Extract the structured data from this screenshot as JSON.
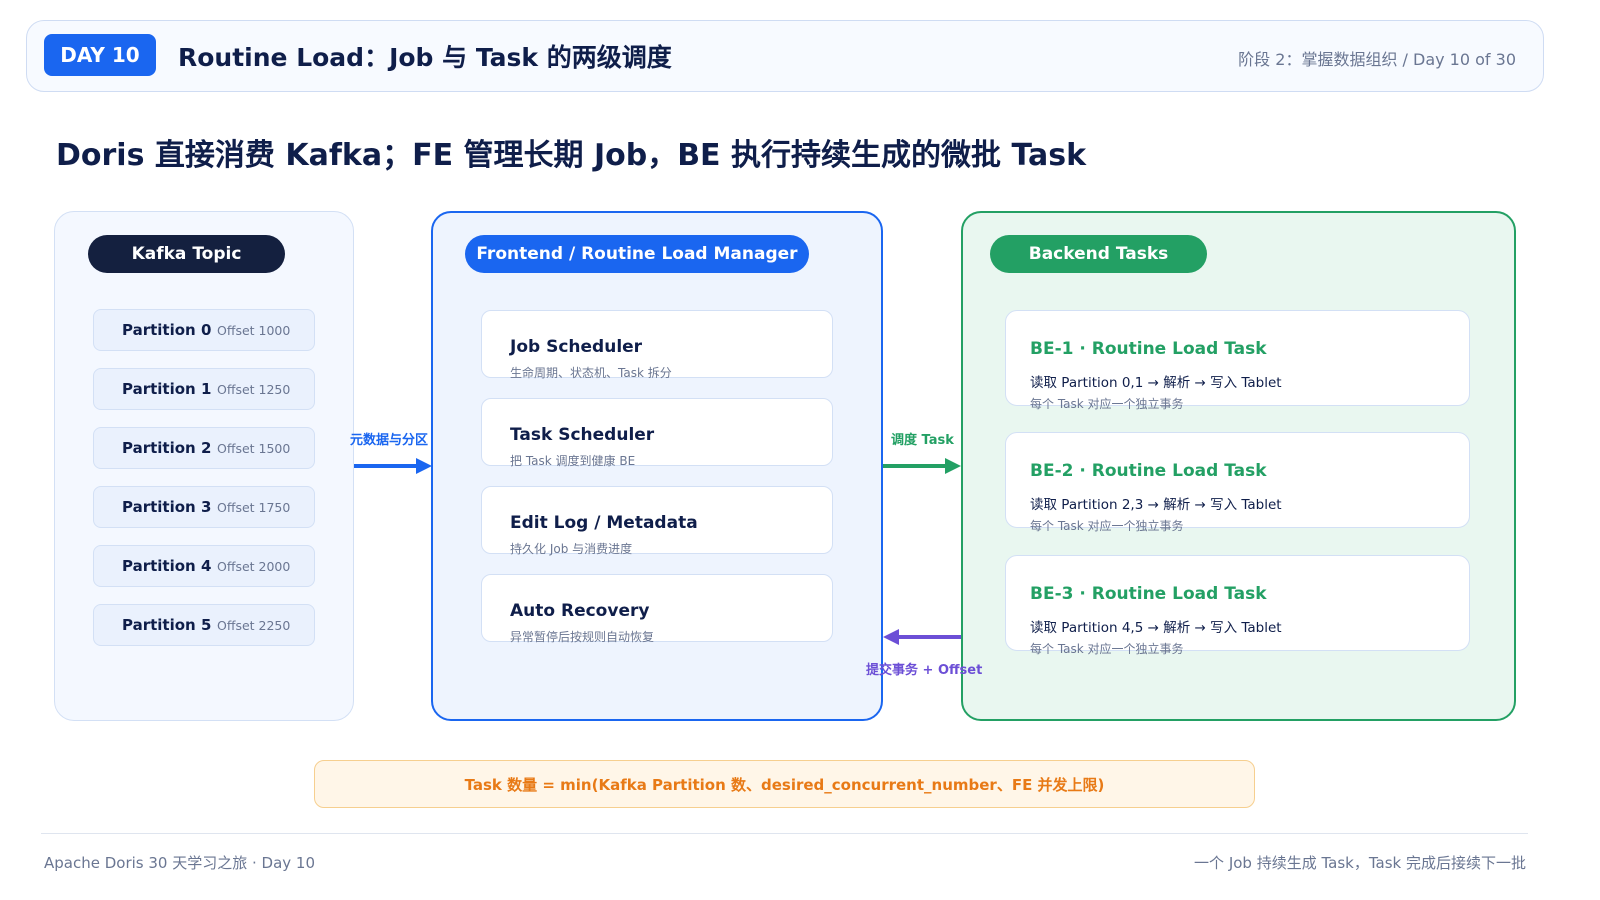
{
  "header": {
    "badge": "DAY 10",
    "title": "Routine Load：Job 与 Task 的两级调度",
    "breadcrumb": "阶段 2：掌握数据组织  /  Day 10 of 30"
  },
  "subtitle": "Doris 直接消费 Kafka；FE 管理长期 Job，BE 执行持续生成的微批 Task",
  "kafka": {
    "title": "Kafka Topic",
    "partitions": [
      {
        "name": "Partition 0",
        "offset": "Offset 1000"
      },
      {
        "name": "Partition 1",
        "offset": "Offset 1250"
      },
      {
        "name": "Partition 2",
        "offset": "Offset 1500"
      },
      {
        "name": "Partition 3",
        "offset": "Offset 1750"
      },
      {
        "name": "Partition 4",
        "offset": "Offset 2000"
      },
      {
        "name": "Partition 5",
        "offset": "Offset 2250"
      }
    ]
  },
  "frontend": {
    "title": "Frontend / Routine Load Manager",
    "modules": [
      {
        "title": "Job Scheduler",
        "desc": "生命周期、状态机、Task 拆分"
      },
      {
        "title": "Task Scheduler",
        "desc": "把 Task 调度到健康 BE"
      },
      {
        "title": "Edit Log / Metadata",
        "desc": "持久化 Job 与消费进度"
      },
      {
        "title": "Auto Recovery",
        "desc": "异常暂停后按规则自动恢复"
      }
    ]
  },
  "backend": {
    "title": "Backend Tasks",
    "tasks": [
      {
        "title": "BE-1 · Routine Load Task",
        "line": "读取 Partition 0,1 → 解析 → 写入 Tablet",
        "note": "每个 Task 对应一个独立事务"
      },
      {
        "title": "BE-2 · Routine Load Task",
        "line": "读取 Partition 2,3 → 解析 → 写入 Tablet",
        "note": "每个 Task 对应一个独立事务"
      },
      {
        "title": "BE-3 · Routine Load Task",
        "line": "读取 Partition 4,5 → 解析 → 写入 Tablet",
        "note": "每个 Task 对应一个独立事务"
      }
    ]
  },
  "arrows": {
    "metadata_label": "元数据与分区",
    "schedule_label": "调度 Task",
    "commit_label": "提交事务 + Offset",
    "colors": {
      "metadata": "#1a66f0",
      "schedule": "#23a064",
      "commit": "#6c4fd6"
    }
  },
  "formula": "Task 数量 = min(Kafka Partition 数、desired_concurrent_number、FE 并发上限)",
  "footer": {
    "left": "Apache Doris 30 天学习之旅 · Day 10",
    "right": "一个 Job 持续生成 Task，Task 完成后接续下一批"
  }
}
